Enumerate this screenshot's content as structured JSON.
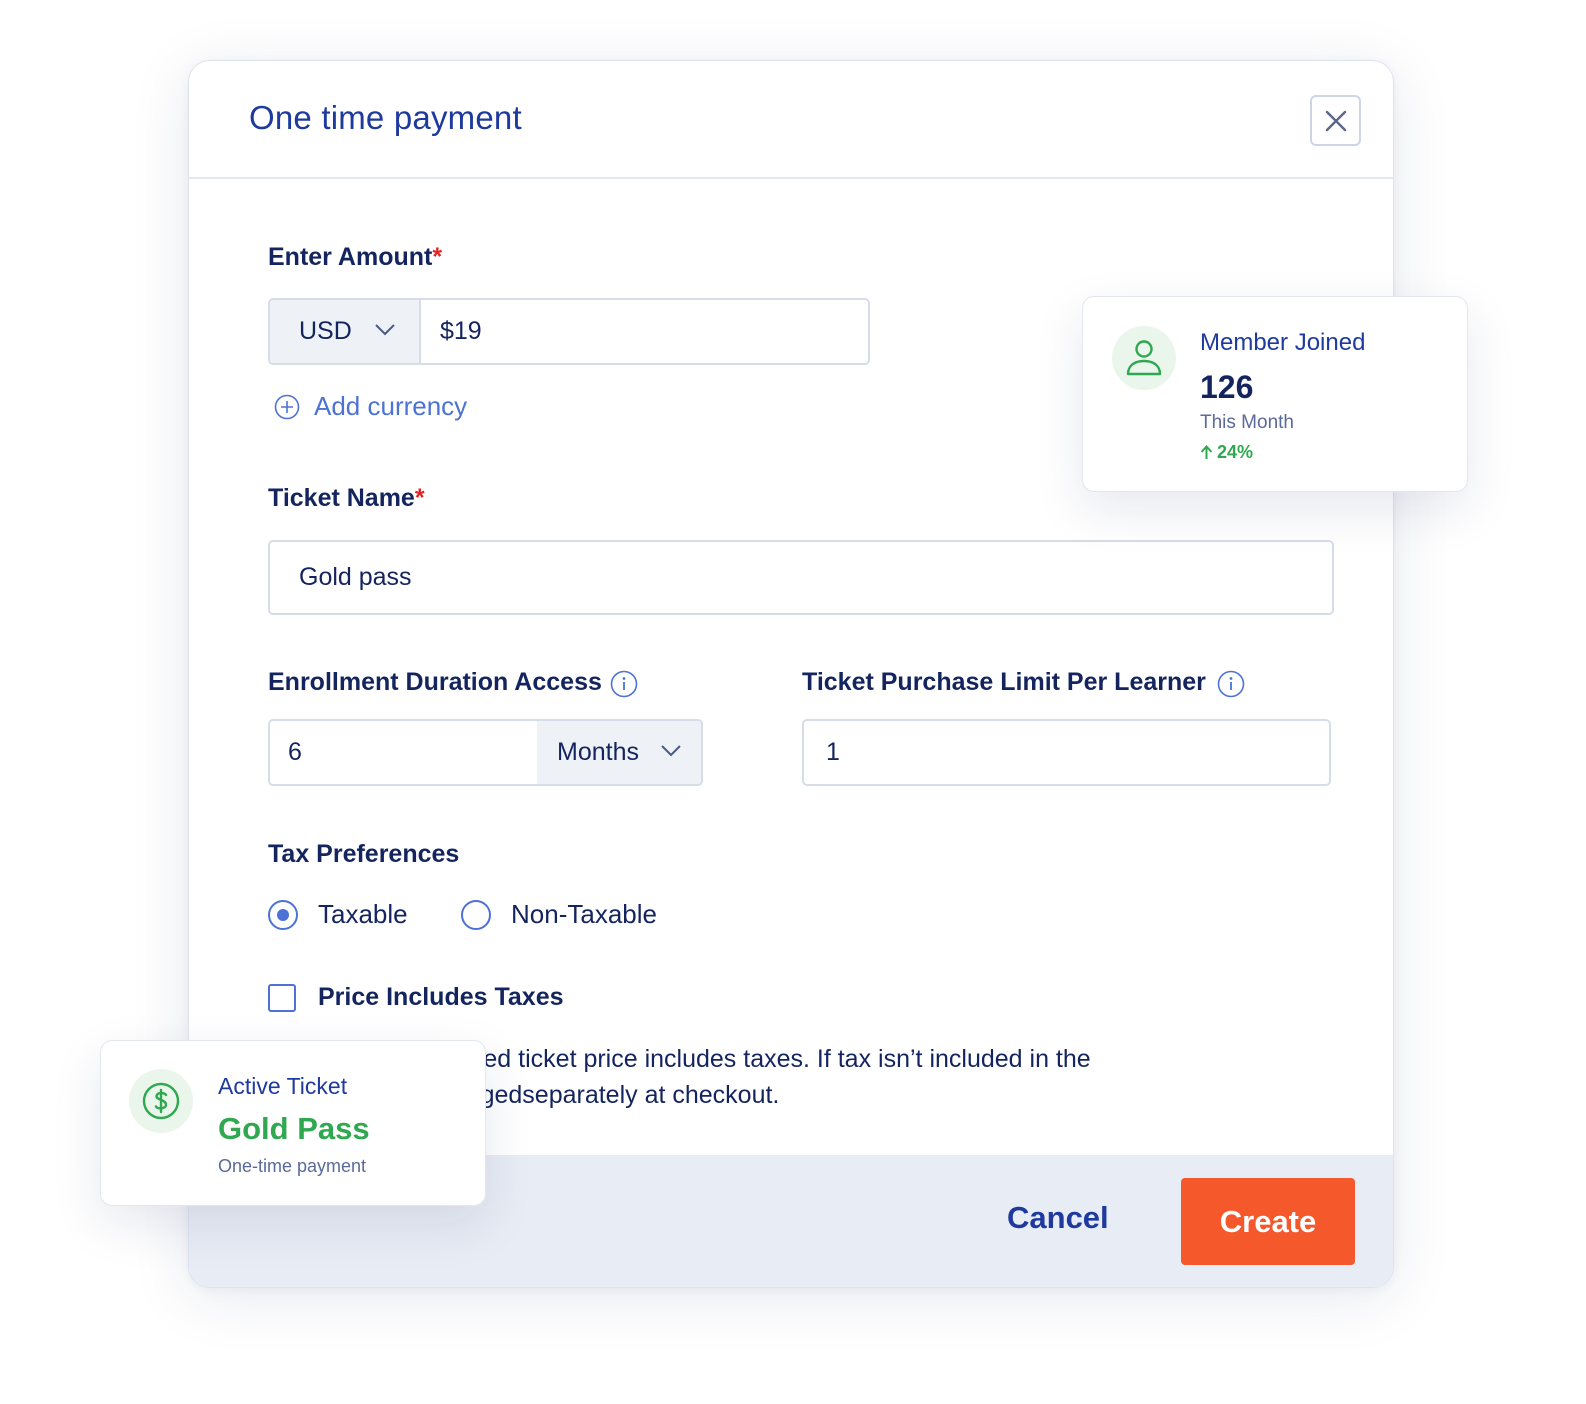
{
  "modal": {
    "title": "One time payment"
  },
  "amount": {
    "label": "Enter Amount",
    "required_mark": "*",
    "currency": "USD",
    "value": "$19",
    "add_currency": "Add currency"
  },
  "ticket_name": {
    "label": "Ticket Name",
    "required_mark": "*",
    "value": "Gold pass"
  },
  "enrollment": {
    "label": "Enrollment Duration Access",
    "value": "6",
    "unit": "Months"
  },
  "purchase_limit": {
    "label": "Ticket Purchase Limit Per Learner",
    "value": "1"
  },
  "tax": {
    "label": "Tax Preferences",
    "options": [
      "Taxable",
      "Non-Taxable"
    ],
    "selected": "Taxable",
    "includes_label": "Price Includes Taxes",
    "includes_checked": false,
    "help_line1": "The above-mentioned ticket price includes taxes. If tax isn’t included in the",
    "help_line2": "price, it will be chargedseparately at checkout."
  },
  "footer": {
    "cancel": "Cancel",
    "create": "Create"
  },
  "member_card": {
    "title": "Member Joined",
    "count": "126",
    "period": "This Month",
    "delta": "24%"
  },
  "ticket_card": {
    "title": "Active Ticket",
    "name": "Gold Pass",
    "type": "One-time payment"
  },
  "colors": {
    "accent": "#1f3a9e",
    "link": "#4d72d6",
    "create_button": "#f4582b",
    "success": "#2fa84f",
    "required": "#e02424"
  },
  "icons": [
    "close-icon",
    "chevron-down-icon",
    "plus-circle-icon",
    "info-icon",
    "user-icon",
    "arrow-up-icon",
    "dollar-circle-icon"
  ]
}
